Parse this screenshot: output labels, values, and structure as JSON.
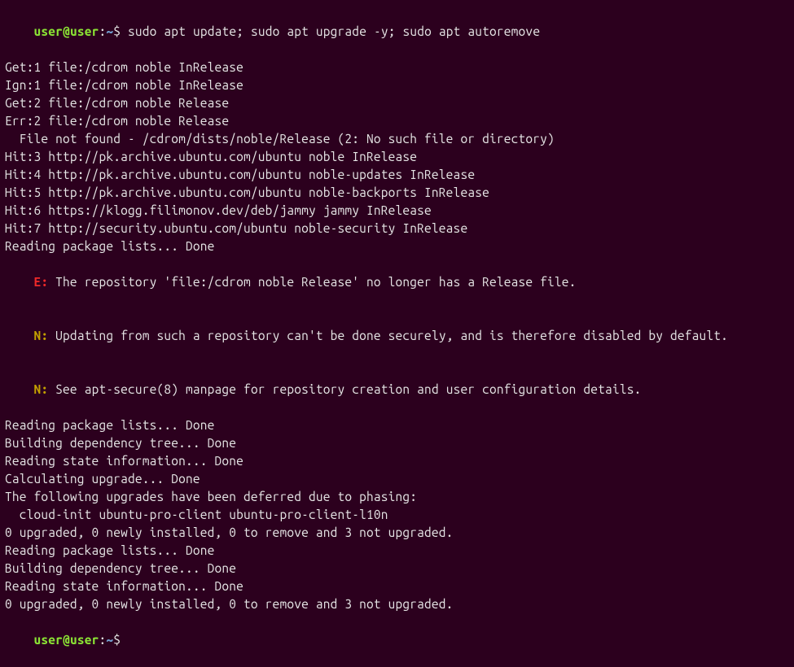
{
  "prompt1": {
    "user": "user",
    "at": "@",
    "host": "user",
    "colon": ":",
    "path": "~",
    "dollar": "$ ",
    "command": "sudo apt update; sudo apt upgrade -y; sudo apt autoremove"
  },
  "lines": [
    "Get:1 file:/cdrom noble InRelease",
    "Ign:1 file:/cdrom noble InRelease",
    "Get:2 file:/cdrom noble Release",
    "Err:2 file:/cdrom noble Release",
    "  File not found - /cdrom/dists/noble/Release (2: No such file or directory)",
    "Hit:3 http://pk.archive.ubuntu.com/ubuntu noble InRelease",
    "Hit:4 http://pk.archive.ubuntu.com/ubuntu noble-updates InRelease",
    "Hit:5 http://pk.archive.ubuntu.com/ubuntu noble-backports InRelease",
    "Hit:6 https://klogg.filimonov.dev/deb/jammy jammy InRelease",
    "Hit:7 http://security.ubuntu.com/ubuntu noble-security InRelease",
    "Reading package lists... Done"
  ],
  "err_line": {
    "tag": "E:",
    "text": " The repository 'file:/cdrom noble Release' no longer has a Release file."
  },
  "note1": {
    "tag": "N:",
    "text": " Updating from such a repository can't be done securely, and is therefore disabled by default."
  },
  "note2": {
    "tag": "N:",
    "text": " See apt-secure(8) manpage for repository creation and user configuration details."
  },
  "lines2": [
    "Reading package lists... Done",
    "Building dependency tree... Done",
    "Reading state information... Done",
    "Calculating upgrade... Done",
    "The following upgrades have been deferred due to phasing:",
    "  cloud-init ubuntu-pro-client ubuntu-pro-client-l10n",
    "0 upgraded, 0 newly installed, 0 to remove and 3 not upgraded.",
    "Reading package lists... Done",
    "Building dependency tree... Done",
    "Reading state information... Done",
    "0 upgraded, 0 newly installed, 0 to remove and 3 not upgraded."
  ],
  "prompt2": {
    "user": "user",
    "at": "@",
    "host": "user",
    "colon": ":",
    "path": "~",
    "dollar": "$"
  }
}
